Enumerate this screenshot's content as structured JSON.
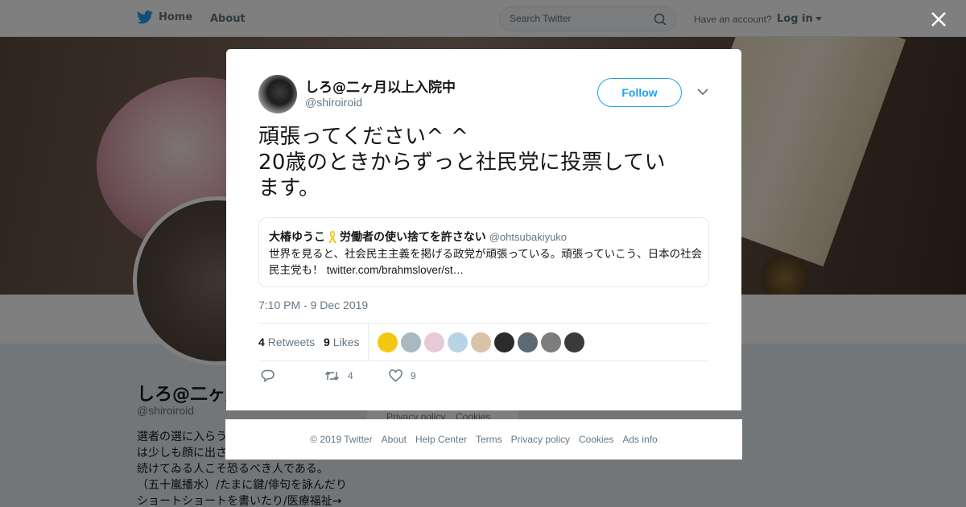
{
  "topbar": {
    "home_label": "Home",
    "about_label": "About",
    "search_placeholder": "Search Twitter",
    "have_account_text": "Have an account?",
    "login_label": "Log in",
    "twitter_blue": "#1da1f2"
  },
  "background_profile": {
    "name": "しろ@二ヶ月以上入院中",
    "handle": "@shiroiroid",
    "bio_lines": [
      "選者の選に入らう",
      "は少しも顔に出さ",
      "続けてゐる人こそ恐るべき人である。",
      "（五十嵐播水）/たまに鍵/俳句を詠んだり",
      "ショートショートを書いたり/医療福祉→"
    ],
    "footer_peek": [
      "Privacy policy",
      "Cookies"
    ]
  },
  "tweet": {
    "author_name": "しろ@二ヶ月以上入院中",
    "author_handle": "@shiroiroid",
    "follow_label": "Follow",
    "text_lines": [
      "頑張ってください^ ^",
      "20歳のときからずっと社民党に投票してい",
      "ます。"
    ],
    "quoted": {
      "name_part1": "大椿ゆうこ",
      "name_part2": "労働者の使い捨てを許さない",
      "handle": "@ohtsubakiyuko",
      "text": "世界を見ると、社会民主主義を掲げる政党が頑張っている。頑張っていこう、日本の社会民主党も！",
      "link": "twitter.com/brahmslover/st…"
    },
    "timestamp": "7:10 PM - 9 Dec 2019",
    "retweets_count": "4",
    "retweets_label": "Retweets",
    "likes_count": "9",
    "likes_label": "Likes",
    "likers": [
      {
        "name": "liker-1",
        "color": "#f2c811"
      },
      {
        "name": "liker-2",
        "color": "#aab8c2"
      },
      {
        "name": "liker-3",
        "color": "#e7c9d8"
      },
      {
        "name": "liker-4",
        "color": "#b9d3e6"
      },
      {
        "name": "liker-5",
        "color": "#d9c2a7"
      },
      {
        "name": "liker-6",
        "color": "#2b2b2b"
      },
      {
        "name": "liker-7",
        "color": "#5b6a74"
      },
      {
        "name": "liker-8",
        "color": "#7d7d7d"
      },
      {
        "name": "liker-9",
        "color": "#3a3a3a"
      }
    ],
    "action_retweet_count": "4",
    "action_like_count": "9"
  },
  "footer": {
    "links": [
      "© 2019 Twitter",
      "About",
      "Help Center",
      "Terms",
      "Privacy policy",
      "Cookies",
      "Ads info"
    ]
  }
}
